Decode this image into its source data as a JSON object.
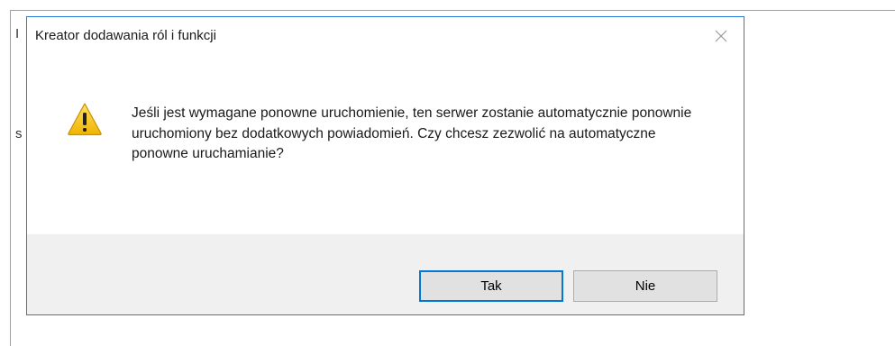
{
  "background_window": {
    "glyph_top": "I",
    "glyph_mid": "s"
  },
  "dialog": {
    "title": "Kreator dodawania ról i funkcji",
    "close_glyph": "✕",
    "icon": "warning-triangle-icon",
    "message": "Jeśli jest wymagane ponowne uruchomienie, ten serwer zostanie automatycznie ponownie uruchomiony bez dodatkowych powiadomień. Czy chcesz zezwolić na automatyczne ponowne uruchamianie?",
    "buttons": {
      "yes_label": "Tak",
      "no_label": "Nie"
    },
    "colors": {
      "border": "#2a7ad8",
      "footer": "#f0f0f0",
      "highlight": "#f4f400",
      "warning": "#f2c100"
    }
  }
}
